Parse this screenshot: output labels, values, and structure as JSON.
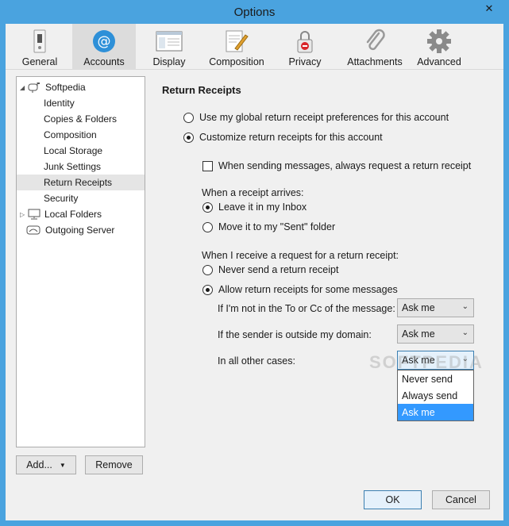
{
  "window": {
    "title": "Options",
    "close_glyph": "✕"
  },
  "tabs": [
    {
      "label": "General",
      "icon": "switch-icon",
      "active": false
    },
    {
      "label": "Accounts",
      "icon": "at-sign-icon",
      "active": true
    },
    {
      "label": "Display",
      "icon": "window-icon",
      "active": false
    },
    {
      "label": "Composition",
      "icon": "pen-paper-icon",
      "active": false
    },
    {
      "label": "Privacy",
      "icon": "lock-icon",
      "active": false
    },
    {
      "label": "Attachments",
      "icon": "paperclip-icon",
      "active": false
    },
    {
      "label": "Advanced",
      "icon": "gear-icon",
      "active": false
    }
  ],
  "sidebar": {
    "items": [
      {
        "label": "Softpedia",
        "icon": "mailbox-icon"
      },
      {
        "label": "Identity"
      },
      {
        "label": "Copies & Folders"
      },
      {
        "label": "Composition"
      },
      {
        "label": "Local Storage"
      },
      {
        "label": "Junk Settings"
      },
      {
        "label": "Return Receipts",
        "selected": true
      },
      {
        "label": "Security"
      },
      {
        "label": "Local Folders",
        "icon": "monitor-icon"
      },
      {
        "label": "Outgoing Server",
        "icon": "outgoing-server-icon"
      }
    ],
    "add_label": "Add...",
    "remove_label": "Remove"
  },
  "main": {
    "heading": "Return Receipts",
    "use_global": "Use my global return receipt preferences for this account",
    "customize": "Customize return receipts for this account",
    "always_request": "When sending messages, always request a return receipt",
    "when_arrives": "When a receipt arrives:",
    "leave_inbox": "Leave it in my Inbox",
    "move_sent": "Move it to my \"Sent\" folder",
    "when_request": "When I receive a request for a return receipt:",
    "never_send": "Never send a return receipt",
    "allow_some": "Allow return receipts for some messages",
    "not_in_to": "If I'm not in the To or Cc of the message:",
    "sender_outside": "If the sender is outside my domain:",
    "all_other": "In all other cases:",
    "select_value_1": "Ask me",
    "select_value_2": "Ask me",
    "select_value_3": "Ask me",
    "dropdown_options": [
      "Never send",
      "Always send",
      "Ask me"
    ],
    "watermark": "SOFTPEDIA"
  },
  "footer": {
    "ok_label": "OK",
    "cancel_label": "Cancel"
  }
}
